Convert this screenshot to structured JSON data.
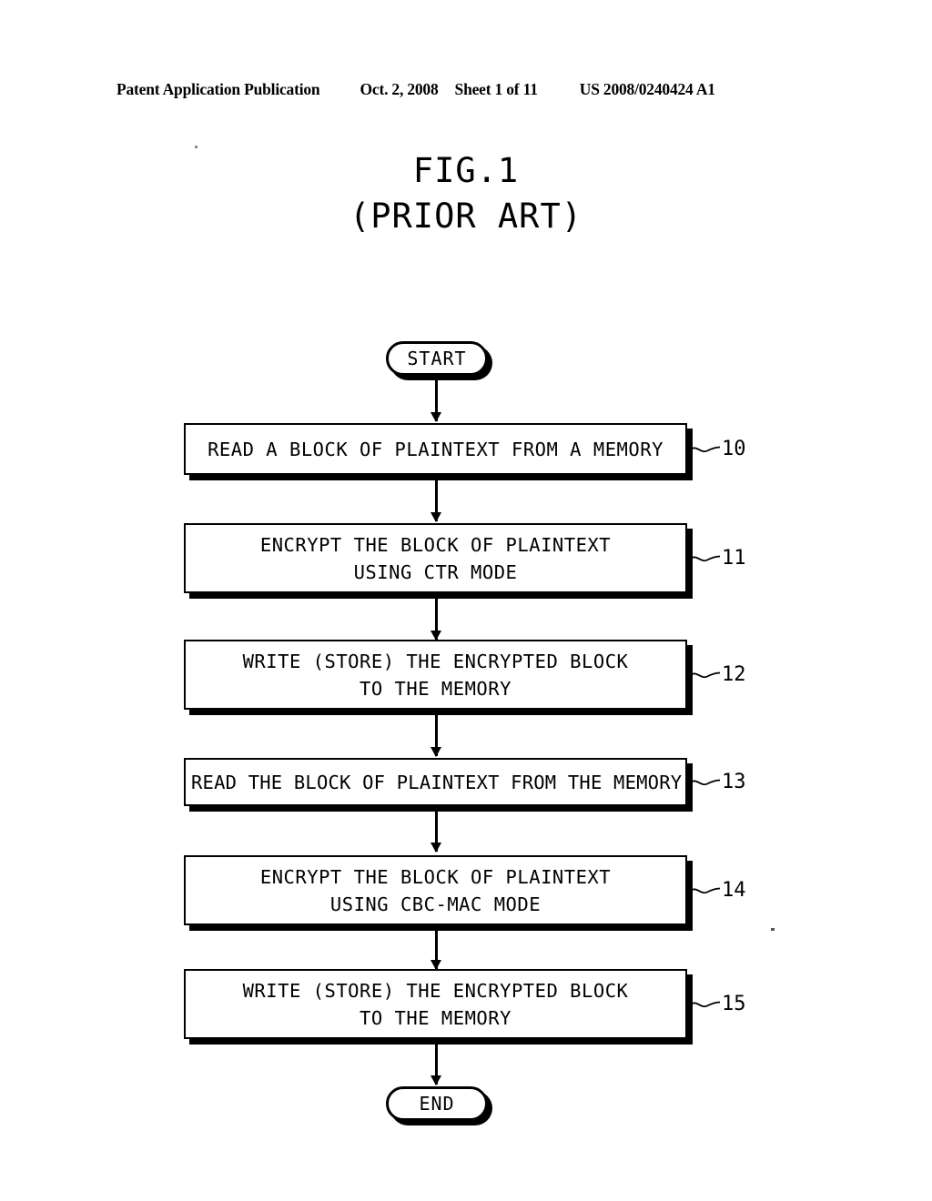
{
  "header": {
    "publication": "Patent Application Publication",
    "date": "Oct. 2, 2008",
    "sheet": "Sheet 1 of 11",
    "patent_number": "US 2008/0240424 A1"
  },
  "figure": {
    "title": "FIG.1",
    "subtitle": "(PRIOR ART)"
  },
  "flowchart": {
    "start_label": "START",
    "end_label": "END",
    "steps": [
      {
        "ref": "10",
        "lines": [
          "READ A BLOCK OF PLAINTEXT FROM A MEMORY"
        ]
      },
      {
        "ref": "11",
        "lines": [
          "ENCRYPT THE BLOCK OF PLAINTEXT",
          "USING CTR MODE"
        ]
      },
      {
        "ref": "12",
        "lines": [
          "WRITE (STORE) THE ENCRYPTED BLOCK",
          "TO THE MEMORY"
        ]
      },
      {
        "ref": "13",
        "lines": [
          "READ THE BLOCK OF PLAINTEXT FROM THE MEMORY"
        ]
      },
      {
        "ref": "14",
        "lines": [
          "ENCRYPT THE BLOCK OF PLAINTEXT",
          "USING CBC-MAC MODE"
        ]
      },
      {
        "ref": "15",
        "lines": [
          "WRITE (STORE) THE ENCRYPTED BLOCK",
          "TO THE MEMORY"
        ]
      }
    ]
  },
  "colors": {
    "ink": "#000000",
    "paper": "#ffffff"
  }
}
